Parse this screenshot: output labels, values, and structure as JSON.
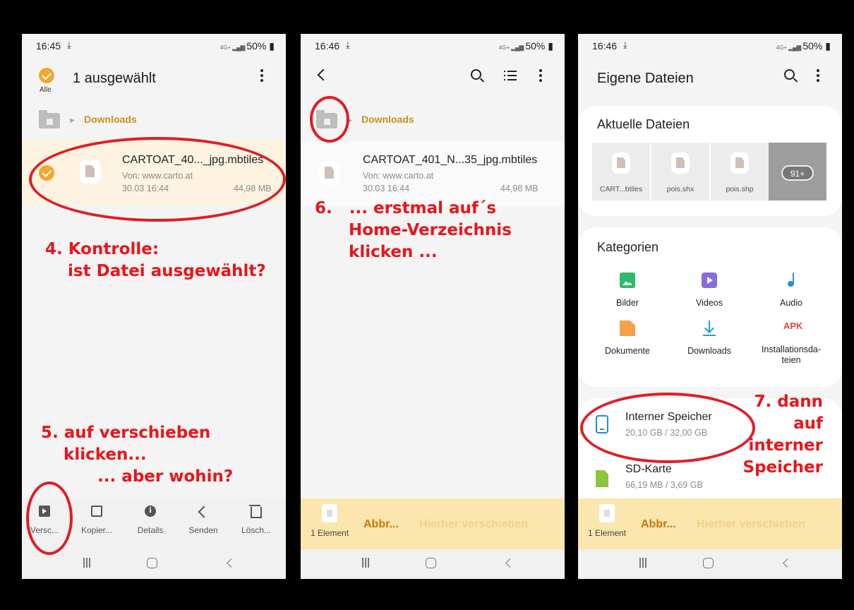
{
  "common": {
    "battery": "50%",
    "net_label": "4G+"
  },
  "phone1": {
    "time": "16:45",
    "title": "1 ausgewählt",
    "select_all": "Alle",
    "breadcrumb": "Downloads",
    "file": {
      "name": "CARTOAT_40..._jpg.mbtiles",
      "source": "Von: www.carto.at",
      "date": "30.03 16:44",
      "size": "44,98 MB"
    },
    "toolbar": [
      {
        "label": "Versc...",
        "icon": "move-icon"
      },
      {
        "label": "Kopier...",
        "icon": "copy-icon"
      },
      {
        "label": "Details",
        "icon": "info-icon"
      },
      {
        "label": "Senden",
        "icon": "share-icon"
      },
      {
        "label": "Lösch...",
        "icon": "trash-icon"
      }
    ]
  },
  "phone2": {
    "time": "16:46",
    "breadcrumb": "Downloads",
    "file": {
      "name": "CARTOAT_401_N...35_jpg.mbtiles",
      "source": "Von: www.carto.at",
      "date": "30.03 16:44",
      "size": "44,98 MB"
    },
    "bottom": {
      "element_count": "1 Element",
      "cancel": "Abbr...",
      "move_here": "Hierher verschieben"
    }
  },
  "phone3": {
    "time": "16:46",
    "title": "Eigene Dateien",
    "recent": {
      "title": "Aktuelle Dateien",
      "files": [
        "CART...btiles",
        "pois.shx",
        "pois.shp"
      ],
      "more": "91+"
    },
    "categories": {
      "title": "Kategorien",
      "items": [
        {
          "label": "Bilder",
          "icon": "image-icon"
        },
        {
          "label": "Videos",
          "icon": "video-icon"
        },
        {
          "label": "Audio",
          "icon": "audio-icon"
        },
        {
          "label": "Dokumente",
          "icon": "document-icon"
        },
        {
          "label": "Downloads",
          "icon": "download-icon"
        },
        {
          "label": "Installationsda-\nteien",
          "icon": "APK"
        }
      ]
    },
    "storage": [
      {
        "name": "Interner Speicher",
        "size": "20,10 GB / 32,00 GB"
      },
      {
        "name": "SD-Karte",
        "size": "66,19 MB / 3,69 GB"
      }
    ],
    "bottom": {
      "element_count": "1 Element",
      "cancel": "Abbr...",
      "move_here": "Hierher verschieben"
    }
  },
  "annotations": {
    "a4": "4. Kontrolle:\n    ist Datei ausgewählt?",
    "a5": "5. auf verschieben\n    klicken...\n          ... aber wohin?",
    "a6": "6.   ... erstmal auf´s\n      Home-Verzeichnis\n      klicken ...",
    "a7": "7. dann\nauf\ninterner\nSpeicher"
  },
  "colors": {
    "accent_orange": "#f0a830",
    "annotation_red": "#e8151b",
    "move_bar": "#fbe6ad"
  }
}
